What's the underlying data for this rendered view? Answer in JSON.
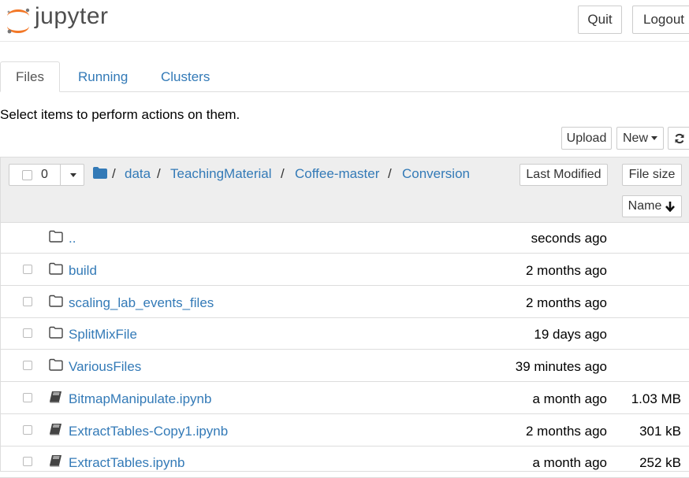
{
  "header": {
    "logo_text": "jupyter",
    "quit_label": "Quit",
    "logout_label": "Logout"
  },
  "tabs": [
    {
      "label": "Files",
      "active": true
    },
    {
      "label": "Running",
      "active": false
    },
    {
      "label": "Clusters",
      "active": false
    }
  ],
  "instructions": "Select items to perform actions on them.",
  "toolbar": {
    "upload_label": "Upload",
    "new_label": "New",
    "refresh_icon": "refresh-icon"
  },
  "list_header": {
    "selected_count": "0",
    "breadcrumb": [
      "data",
      "TeachingMaterial",
      "Coffee-master",
      "Conversion"
    ],
    "sort_last_modified": "Last Modified",
    "sort_file_size": "File size",
    "sort_name": "Name"
  },
  "rows": [
    {
      "name": "..",
      "modified": "seconds ago",
      "size": "",
      "kind": "folder",
      "checkbox": false
    },
    {
      "name": "build",
      "modified": "2 months ago",
      "size": "",
      "kind": "folder",
      "checkbox": true
    },
    {
      "name": "scaling_lab_events_files",
      "modified": "2 months ago",
      "size": "",
      "kind": "folder",
      "checkbox": true
    },
    {
      "name": "SplitMixFile",
      "modified": "19 days ago",
      "size": "",
      "kind": "folder",
      "checkbox": true
    },
    {
      "name": "VariousFiles",
      "modified": "39 minutes ago",
      "size": "",
      "kind": "folder",
      "checkbox": true
    },
    {
      "name": "BitmapManipulate.ipynb",
      "modified": "a month ago",
      "size": "1.03 MB",
      "kind": "notebook",
      "checkbox": true
    },
    {
      "name": "ExtractTables-Copy1.ipynb",
      "modified": "2 months ago",
      "size": "301 kB",
      "kind": "notebook",
      "checkbox": true
    },
    {
      "name": "ExtractTables.ipynb",
      "modified": "a month ago",
      "size": "252 kB",
      "kind": "notebook",
      "checkbox": true
    }
  ],
  "colors": {
    "link": "#337ab7",
    "logo_orange": "#f37726",
    "header_bg": "#eeeeee"
  }
}
